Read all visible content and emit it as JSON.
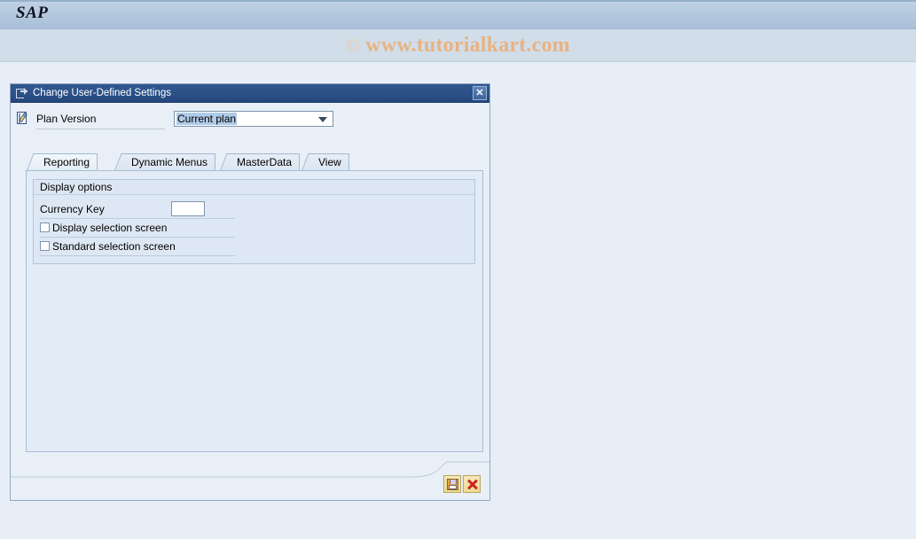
{
  "app": {
    "logo_text": "SAP",
    "watermark_mark": "©",
    "watermark_text": "www.tutorialkart.com"
  },
  "dialog": {
    "title": "Change User-Defined Settings",
    "title_icon": "enter-session-icon",
    "close_label": "✕",
    "plan_version": {
      "icon": "change-document-icon",
      "label": "Plan Version",
      "value": "Current plan",
      "placeholder": ""
    },
    "tabs": [
      {
        "label": "Reporting",
        "active": true
      },
      {
        "label": "Dynamic Menus",
        "active": false
      },
      {
        "label": "MasterData",
        "active": false
      },
      {
        "label": "View",
        "active": false
      }
    ],
    "reporting_tab": {
      "group_title": "Display options",
      "currency_key": {
        "label": "Currency Key",
        "value": "",
        "placeholder": ""
      },
      "checkboxes": [
        {
          "label": "Display selection screen",
          "checked": false
        },
        {
          "label": "Standard selection screen",
          "checked": false
        }
      ]
    },
    "footer": {
      "save_icon": "save-floppy-icon",
      "cancel_icon": "cancel-red-x-icon"
    }
  },
  "colors": {
    "header_gradient_top": "#c3d4e6",
    "header_gradient_bottom": "#a9c0d8",
    "header_band": "#d1dde9",
    "page_background": "#e8eef7",
    "titlebar_blue": "#2c5189",
    "watermark_orange": "#e8b383",
    "panel_background": "#e3ecf6",
    "groupbox_background": "#dee8f4",
    "selection_highlight": "#aecbe8",
    "button_yellow": "#f1dd9f"
  }
}
